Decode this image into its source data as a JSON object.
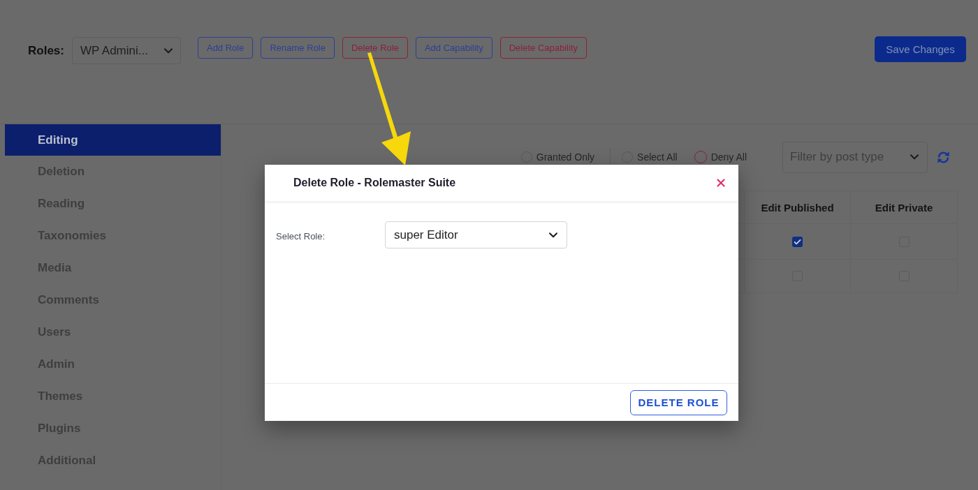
{
  "header": {
    "roles_label": "Roles:",
    "role_select": {
      "value": "WP Admini..."
    },
    "buttons": [
      {
        "label": "Add Role",
        "kind": "default"
      },
      {
        "label": "Rename Role",
        "kind": "default"
      },
      {
        "label": "Delete Role",
        "kind": "danger"
      },
      {
        "label": "Add Capability",
        "kind": "default"
      },
      {
        "label": "Delete Capability",
        "kind": "danger"
      }
    ],
    "save_button": "Save Changes"
  },
  "sidebar": {
    "items": [
      {
        "label": "Editing",
        "selected": true
      },
      {
        "label": "Deletion",
        "selected": false
      },
      {
        "label": "Reading",
        "selected": false
      },
      {
        "label": "Taxonomies",
        "selected": false
      },
      {
        "label": "Media",
        "selected": false
      },
      {
        "label": "Comments",
        "selected": false
      },
      {
        "label": "Users",
        "selected": false
      },
      {
        "label": "Admin",
        "selected": false
      },
      {
        "label": "Themes",
        "selected": false
      },
      {
        "label": "Plugins",
        "selected": false
      },
      {
        "label": "Additional",
        "selected": false
      }
    ]
  },
  "filters": {
    "options": [
      {
        "label": "Granted Only",
        "selected": false,
        "kind": "default"
      },
      {
        "label": "Select All",
        "selected": false,
        "kind": "default"
      },
      {
        "label": "Deny All",
        "selected": false,
        "kind": "danger"
      }
    ],
    "post_type_select": {
      "placeholder": "Filter by post type"
    }
  },
  "table": {
    "columns": [
      "Edit Published",
      "Edit Private"
    ],
    "rows": [
      {
        "cells": [
          {
            "checked": true
          },
          {
            "checked": false
          }
        ]
      },
      {
        "cells": [
          {
            "checked": false
          },
          {
            "checked": false
          }
        ]
      }
    ]
  },
  "modal": {
    "title": "Delete Role - Rolemaster Suite",
    "field_label": "Select Role:",
    "role_select": {
      "value": "super Editor"
    },
    "button": "DELETE ROLE"
  }
}
